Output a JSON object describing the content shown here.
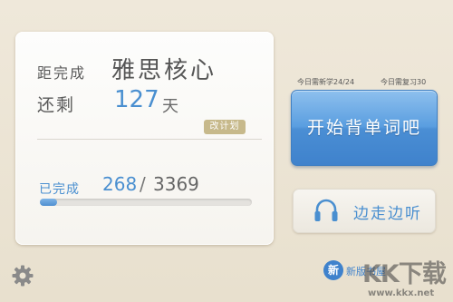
{
  "plan": {
    "target_label": "距完成",
    "target_name": "雅思核心",
    "remain_label": "还剩",
    "days": "127",
    "days_unit": "天",
    "edit_plan_label": "改计划",
    "done_label": "已完成",
    "done_count": "268",
    "slash": "/",
    "total_count": "3369",
    "progress_fraction": 0.0795
  },
  "stats": {
    "new_today": "今日需新学24/24",
    "review_today": "今日需复习30"
  },
  "actions": {
    "start_label": "开始背单词吧",
    "listen_label": "边走边听"
  },
  "footer": {
    "settings_icon": "gear-icon",
    "new_badge": "新",
    "new_label": "新版书屋"
  },
  "watermark": {
    "main": "KK下载",
    "url": "www.kkx.net"
  },
  "colors": {
    "accent": "#4a8fd0",
    "edit_badge": "#c7b98b",
    "background": "#ece5d4"
  }
}
